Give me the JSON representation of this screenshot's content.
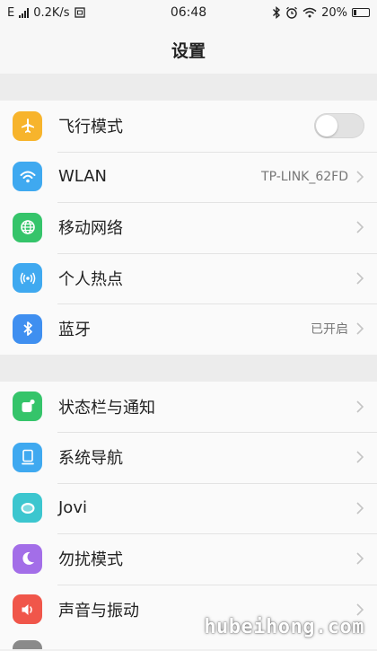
{
  "status_bar": {
    "network": "E",
    "speed": "0.2K/s",
    "time": "06:48",
    "battery": "20%"
  },
  "nav": {
    "title": "设置"
  },
  "groups": [
    {
      "items": [
        {
          "label": "飞行模式",
          "icon": "airplane-icon",
          "icon_color": "#f7b42c",
          "control": "toggle",
          "toggle_on": false
        },
        {
          "label": "WLAN",
          "icon": "wifi-icon",
          "icon_color": "#3fa9f0",
          "value": "TP-LINK_62FD"
        },
        {
          "label": "移动网络",
          "icon": "globe-icon",
          "icon_color": "#35c46a"
        },
        {
          "label": "个人热点",
          "icon": "hotspot-icon",
          "icon_color": "#3fa9f0"
        },
        {
          "label": "蓝牙",
          "icon": "bluetooth-icon",
          "icon_color": "#3f8ff0",
          "value": "已开启"
        }
      ]
    },
    {
      "items": [
        {
          "label": "状态栏与通知",
          "icon": "notification-icon",
          "icon_color": "#35c46a"
        },
        {
          "label": "系统导航",
          "icon": "navigation-icon",
          "icon_color": "#3fa9f0"
        },
        {
          "label": "Jovi",
          "icon": "jovi-icon",
          "icon_color": "#3cc6cf"
        },
        {
          "label": "勿扰模式",
          "icon": "moon-icon",
          "icon_color": "#a36ee8"
        },
        {
          "label": "声音与振动",
          "icon": "speaker-icon",
          "icon_color": "#f0564a"
        }
      ]
    }
  ],
  "watermark": "hubeihong.com"
}
